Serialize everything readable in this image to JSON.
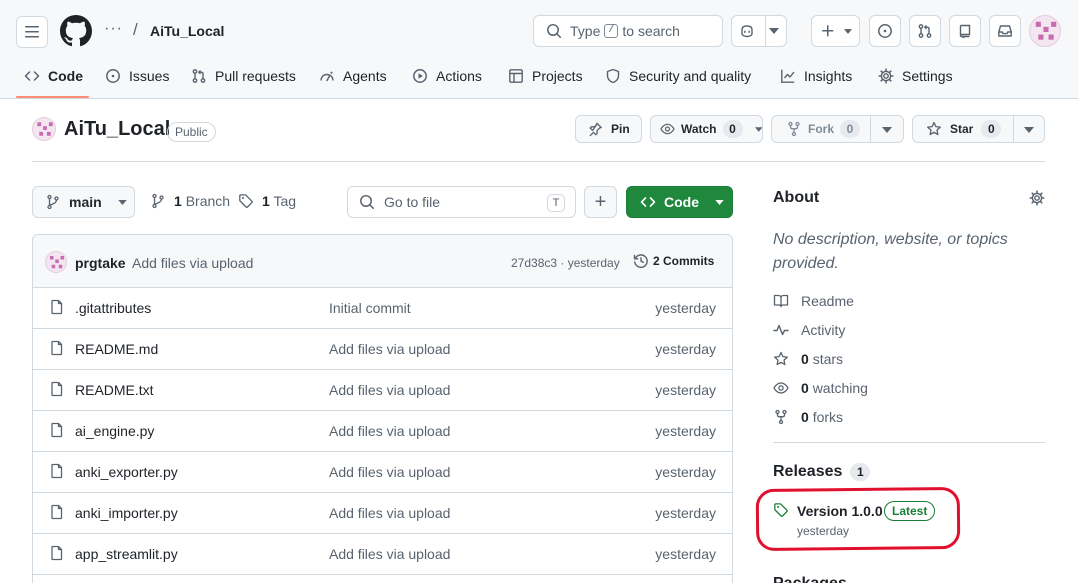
{
  "header": {
    "repo_title": "AiTu_Local",
    "ellipsis": "···",
    "slash": "/",
    "search_type": "Type",
    "search_key": "/",
    "search_rest": "to search"
  },
  "nav": {
    "tabs": [
      {
        "label": "Code",
        "icon": "code-icon",
        "active": true
      },
      {
        "label": "Issues",
        "icon": "issue-opened-icon"
      },
      {
        "label": "Pull requests",
        "icon": "git-pull-request-icon"
      },
      {
        "label": "Agents",
        "icon": "agent-icon"
      },
      {
        "label": "Actions",
        "icon": "play-icon"
      },
      {
        "label": "Projects",
        "icon": "table-icon"
      },
      {
        "label": "Security and quality",
        "icon": "shield-icon"
      },
      {
        "label": "Insights",
        "icon": "graph-icon"
      },
      {
        "label": "Settings",
        "icon": "gear-icon"
      }
    ]
  },
  "repo": {
    "name": "AiTu_Local",
    "visibility": "Public",
    "pin_label": "Pin",
    "watch_label": "Watch",
    "watch_count": "0",
    "fork_label": "Fork",
    "fork_count": "0",
    "star_label": "Star",
    "star_count": "0"
  },
  "toolbar": {
    "branch": "main",
    "branches_count": "1",
    "branches_label": "Branch",
    "tags_count": "1",
    "tags_label": "Tag",
    "go_to_file_placeholder": "Go to file",
    "go_to_file_key": "T",
    "add_label": "+",
    "code_label": "Code"
  },
  "commit": {
    "author": "prgtake",
    "message": "Add files via upload",
    "hash_time": "27d38c3 · yesterday",
    "commits_label": "2 Commits"
  },
  "files": [
    {
      "name": ".gitattributes",
      "message": "Initial commit",
      "date": "yesterday"
    },
    {
      "name": "README.md",
      "message": "Add files via upload",
      "date": "yesterday"
    },
    {
      "name": "README.txt",
      "message": "Add files via upload",
      "date": "yesterday"
    },
    {
      "name": "ai_engine.py",
      "message": "Add files via upload",
      "date": "yesterday"
    },
    {
      "name": "anki_exporter.py",
      "message": "Add files via upload",
      "date": "yesterday"
    },
    {
      "name": "anki_importer.py",
      "message": "Add files via upload",
      "date": "yesterday"
    },
    {
      "name": "app_streamlit.py",
      "message": "Add files via upload",
      "date": "yesterday"
    }
  ],
  "about": {
    "title": "About",
    "description": "No description, website, or topics provided.",
    "readme": "Readme",
    "activity": "Activity",
    "stars_count": "0",
    "stars_label": "stars",
    "watching_count": "0",
    "watching_label": "watching",
    "forks_count": "0",
    "forks_label": "forks"
  },
  "releases": {
    "title": "Releases",
    "count": "1",
    "version": "Version 1.0.0",
    "badge": "Latest",
    "date": "yesterday"
  },
  "packages": {
    "title": "Packages"
  },
  "colors": {
    "accent_green": "#1f883d",
    "nav_underline": "#fd8c73",
    "highlight_red": "#e0102e",
    "border": "#d1d9e0"
  }
}
